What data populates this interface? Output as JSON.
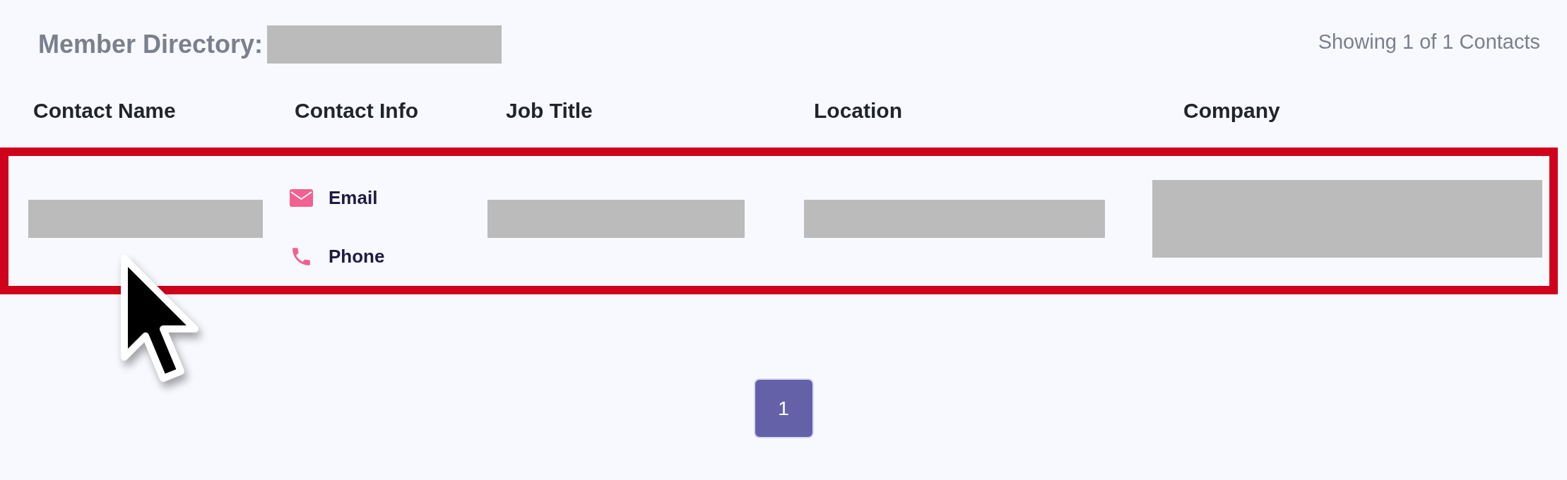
{
  "header": {
    "title": "Member Directory:",
    "title_redacted": true,
    "count_text": "Showing 1 of 1 Contacts"
  },
  "table": {
    "columns": [
      "Contact Name",
      "Contact Info",
      "Job Title",
      "Location",
      "Company"
    ],
    "rows": [
      {
        "highlighted": true,
        "cells": [
          {
            "kind": "redacted"
          },
          {
            "kind": "contacts",
            "links": [
              {
                "kind": "email",
                "label": "Email"
              },
              {
                "kind": "phone",
                "label": "Phone"
              }
            ]
          },
          {
            "kind": "redacted"
          },
          {
            "kind": "redacted"
          },
          {
            "kind": "redacted_tall"
          }
        ]
      }
    ]
  },
  "pagination": [
    {
      "label": "1",
      "selected": true
    }
  ],
  "pointer_cursor": true
}
